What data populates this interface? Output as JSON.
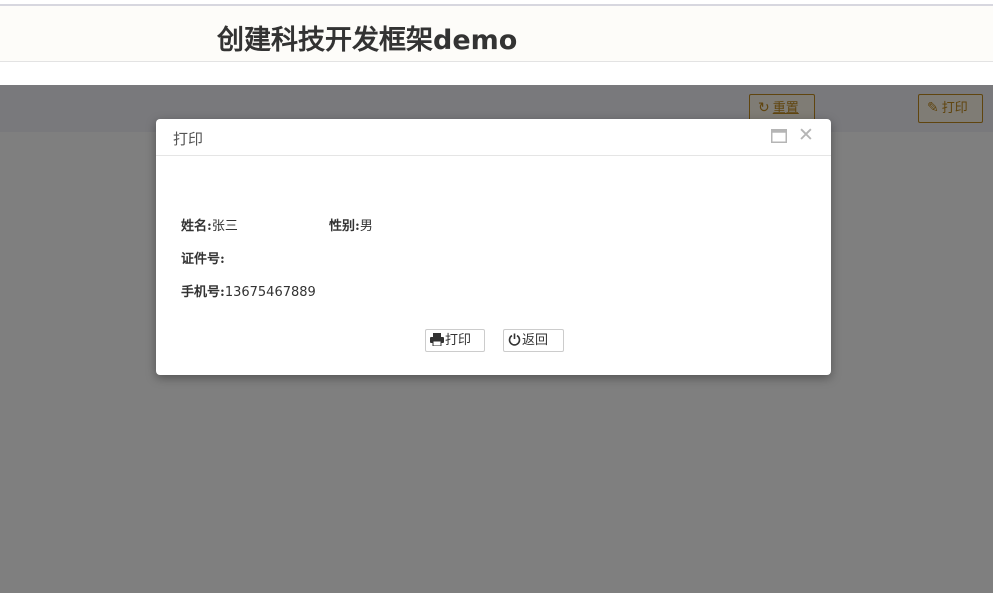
{
  "header": {
    "title": "创建科技开发框架demo"
  },
  "toolbar": {
    "reset_label": "重置",
    "reset_icon": "refresh-icon",
    "print_label": "打印",
    "print_icon": "edit-icon",
    "accent_color": "#c08a1e"
  },
  "dialog": {
    "title": "打印",
    "maximize_icon": "maximize-icon",
    "close_icon": "close-icon",
    "fields": {
      "name_label": "姓名:",
      "name_value": "张三",
      "gender_label": "性别:",
      "gender_value": "男",
      "id_label": "证件号:",
      "id_value": "",
      "phone_label": "手机号:",
      "phone_value": "13675467889"
    },
    "buttons": {
      "print_label": "打印",
      "print_icon": "printer-icon",
      "back_label": "返回",
      "back_icon": "power-icon"
    }
  }
}
